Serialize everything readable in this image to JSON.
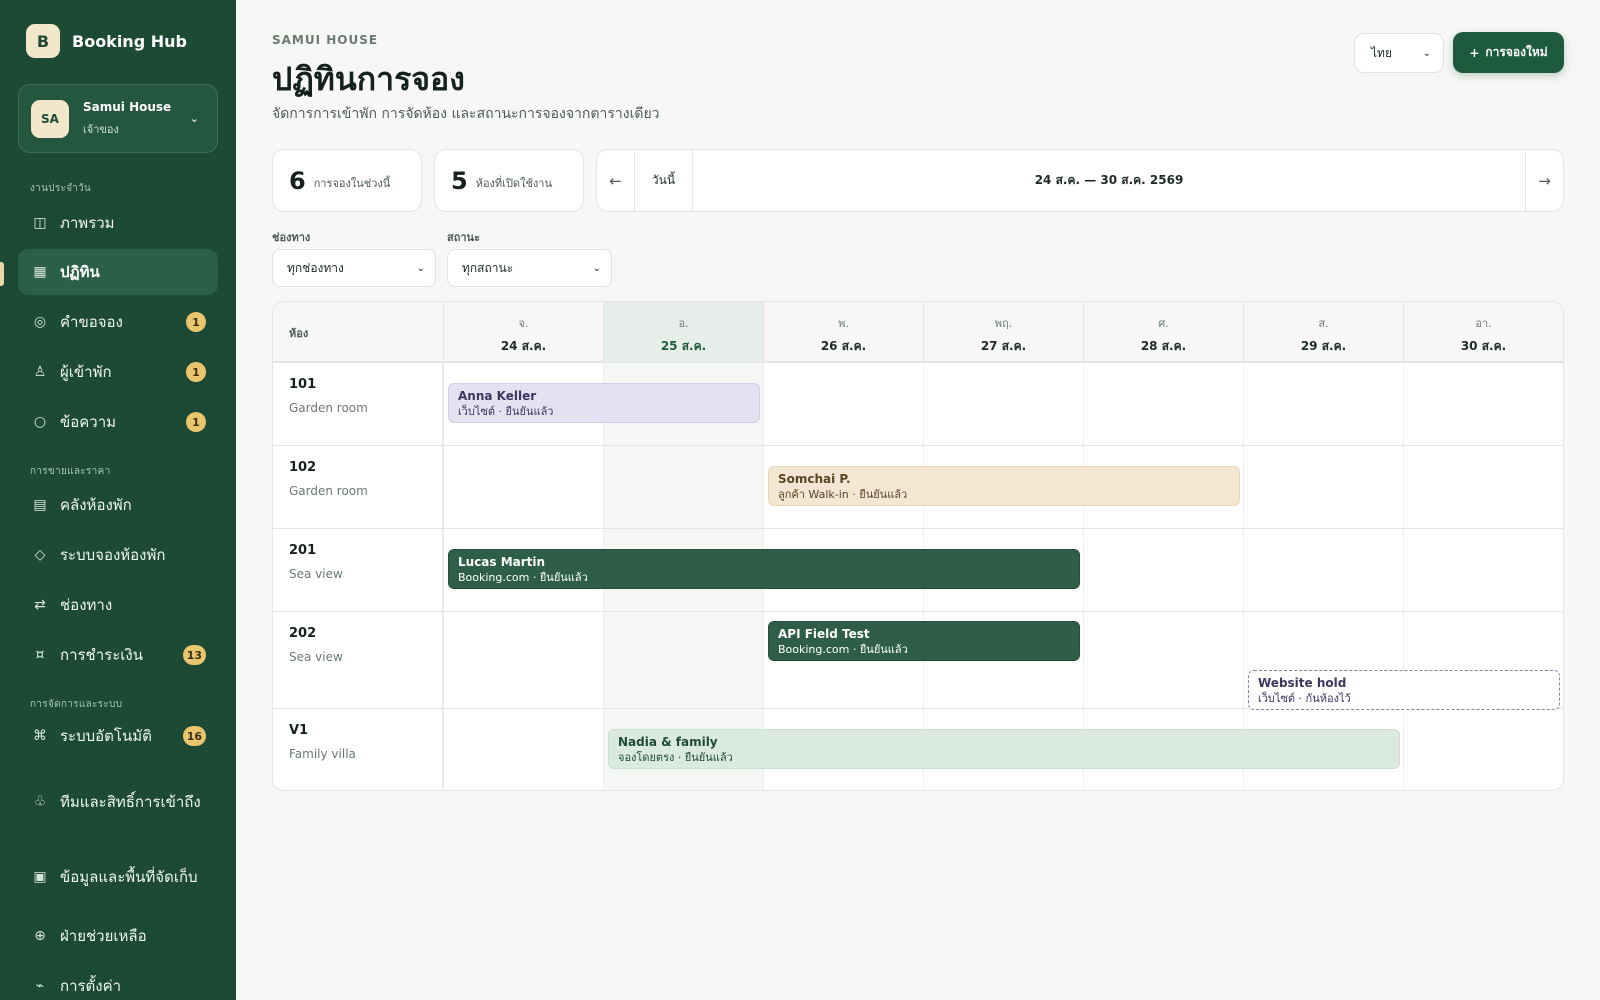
{
  "sidebar": {
    "brand_letter": "B",
    "brand_name": "Booking Hub",
    "account": {
      "initials": "SA",
      "name": "Samui House",
      "role": "เจ้าของ"
    },
    "sections": [
      {
        "label": "งานประจำวัน"
      },
      {
        "label": "การขายและราคา"
      },
      {
        "label": "การจัดการและระบบ"
      }
    ],
    "items": [
      {
        "label": "ภาพรวม",
        "icon": "grid-icon",
        "glyph": "◫"
      },
      {
        "label": "ปฏิทิน",
        "icon": "calendar-icon",
        "glyph": "▦"
      },
      {
        "label": "คำขอจอง",
        "icon": "target-icon",
        "glyph": "◎",
        "badge": "1"
      },
      {
        "label": "ผู้เข้าพัก",
        "icon": "person-icon",
        "glyph": "♙",
        "badge": "1"
      },
      {
        "label": "ข้อความ",
        "icon": "message-icon",
        "glyph": "○",
        "badge": "1"
      },
      {
        "label": "คลังห้องพัก",
        "icon": "inventory-icon",
        "glyph": "▤"
      },
      {
        "label": "ระบบจองห้องพัก",
        "icon": "diamond-icon",
        "glyph": "◇"
      },
      {
        "label": "ช่องทาง",
        "icon": "swap-icon",
        "glyph": "⇄"
      },
      {
        "label": "การชำระเงิน",
        "icon": "payment-icon",
        "glyph": "¤",
        "badge": "13"
      },
      {
        "label": "ระบบอัตโนมัติ",
        "icon": "command-icon",
        "glyph": "⌘",
        "badge": "16"
      },
      {
        "label": "ทีมและสิทธิ์การเข้าถึง",
        "icon": "team-icon",
        "glyph": "♧"
      },
      {
        "label": "ข้อมูลและพื้นที่จัดเก็บ",
        "icon": "storage-icon",
        "glyph": "▣"
      },
      {
        "label": "ฝ่ายช่วยเหลือ",
        "icon": "support-icon",
        "glyph": "⊕"
      },
      {
        "label": "การตั้งค่า",
        "icon": "settings-icon",
        "glyph": "⌁"
      }
    ]
  },
  "header": {
    "eyebrow": "SAMUI HOUSE",
    "title": "ปฏิทินการจอง",
    "subtitle": "จัดการการเข้าพัก การจัดห้อง และสถานะการจองจากตารางเดียว",
    "language": "ไทย",
    "new_booking_icon": "+",
    "new_booking_label": "การจองใหม่"
  },
  "stats": [
    {
      "value": "6",
      "label": "การจองในช่วงนี้"
    },
    {
      "value": "5",
      "label": "ห้องที่เปิดใช้งาน"
    }
  ],
  "week_nav": {
    "prev": "←",
    "today": "วันนี้",
    "range": "24 ส.ค. — 30 ส.ค. 2569",
    "next": "→"
  },
  "filters": {
    "channel": {
      "label": "ช่องทาง",
      "value": "ทุกช่องทาง"
    },
    "status": {
      "label": "สถานะ",
      "value": "ทุกสถานะ"
    }
  },
  "calendar": {
    "room_header": "ห้อง",
    "days": [
      {
        "dow": "จ.",
        "date": "24 ส.ค."
      },
      {
        "dow": "อ.",
        "date": "25 ส.ค.",
        "today": true
      },
      {
        "dow": "พ.",
        "date": "26 ส.ค."
      },
      {
        "dow": "พฤ.",
        "date": "27 ส.ค."
      },
      {
        "dow": "ศ.",
        "date": "28 ส.ค."
      },
      {
        "dow": "ส.",
        "date": "29 ส.ค."
      },
      {
        "dow": "อา.",
        "date": "30 ส.ค."
      }
    ],
    "rooms": [
      {
        "number": "101",
        "type": "Garden room"
      },
      {
        "number": "102",
        "type": "Garden room"
      },
      {
        "number": "201",
        "type": "Sea view"
      },
      {
        "number": "202",
        "type": "Sea view"
      },
      {
        "number": "V1",
        "type": "Family villa"
      }
    ],
    "bookings": [
      {
        "guest": "Anna Keller",
        "meta": "เว็บไซต์ · ยืนยันแล้ว",
        "room": "101",
        "start": "24 ส.ค.",
        "nights": 2,
        "style": "purple"
      },
      {
        "guest": "Somchai P.",
        "meta": "ลูกค้า Walk-in · ยืนยันแล้ว",
        "room": "102",
        "start": "26 ส.ค.",
        "nights": 3,
        "style": "sand"
      },
      {
        "guest": "Lucas Martin",
        "meta": "Booking.com · ยืนยันแล้ว",
        "room": "201",
        "start": "24 ส.ค.",
        "nights": 4,
        "style": "green"
      },
      {
        "guest": "API Field Test",
        "meta": "Booking.com · ยืนยันแล้ว",
        "room": "202",
        "start": "26 ส.ค.",
        "nights": 2,
        "style": "green"
      },
      {
        "guest": "Website hold",
        "meta": "เว็บไซต์ · กันห้องไว้",
        "room": "202",
        "start": "29 ส.ค.",
        "nights": 2,
        "style": "hold"
      },
      {
        "guest": "Nadia & family",
        "meta": "จองโดยตรง · ยืนยันแล้ว",
        "room": "V1",
        "start": "25 ส.ค.",
        "nights": 5,
        "style": "mint"
      }
    ]
  }
}
